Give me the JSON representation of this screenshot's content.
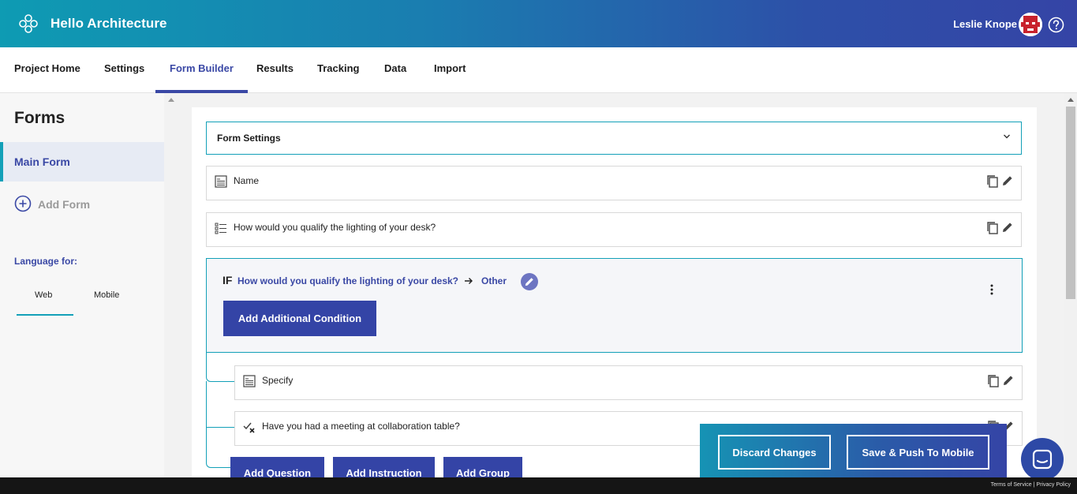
{
  "header": {
    "app_title": "Hello Architecture",
    "user_name": "Leslie Knope",
    "brand_gradient": [
      "#0e9bb3",
      "#3544a6"
    ]
  },
  "tabs": [
    {
      "label": "Project Home",
      "active": false
    },
    {
      "label": "Settings",
      "active": false
    },
    {
      "label": "Form Builder",
      "active": true
    },
    {
      "label": "Results",
      "active": false
    },
    {
      "label": "Tracking",
      "active": false
    },
    {
      "label": "Data",
      "active": false
    },
    {
      "label": "Import",
      "active": false
    }
  ],
  "sidebar": {
    "title": "Forms",
    "forms": [
      {
        "label": "Main Form",
        "selected": true
      }
    ],
    "add_form_label": "Add Form",
    "language_label": "Language for:",
    "language_tabs": [
      {
        "label": "Web",
        "active": true
      },
      {
        "label": "Mobile",
        "active": false
      }
    ]
  },
  "builder": {
    "form_settings_label": "Form Settings",
    "questions": [
      {
        "text": "Name",
        "icon": "text-field-icon"
      },
      {
        "text": "How would you qualify the lighting of your desk?",
        "icon": "list-icon"
      }
    ],
    "condition": {
      "keyword": "IF",
      "question": "How would you qualify the lighting of your desk?",
      "answer": "Other",
      "add_condition_label": "Add Additional Condition",
      "sub_questions": [
        {
          "text": "Specify",
          "icon": "text-field-icon"
        },
        {
          "text": "Have you had a meeting at collaboration table?",
          "icon": "yes-no-icon"
        }
      ],
      "add_buttons": [
        "Add Question",
        "Add Instruction",
        "Add Group"
      ]
    }
  },
  "actions": {
    "discard_label": "Discard Changes",
    "save_label": "Save & Push To Mobile"
  },
  "footer": {
    "terms": "Terms of Service",
    "separator": "|",
    "privacy": "Privacy Policy"
  },
  "colors": {
    "accent_blue": "#3444a6",
    "teal": "#13a0b8"
  }
}
